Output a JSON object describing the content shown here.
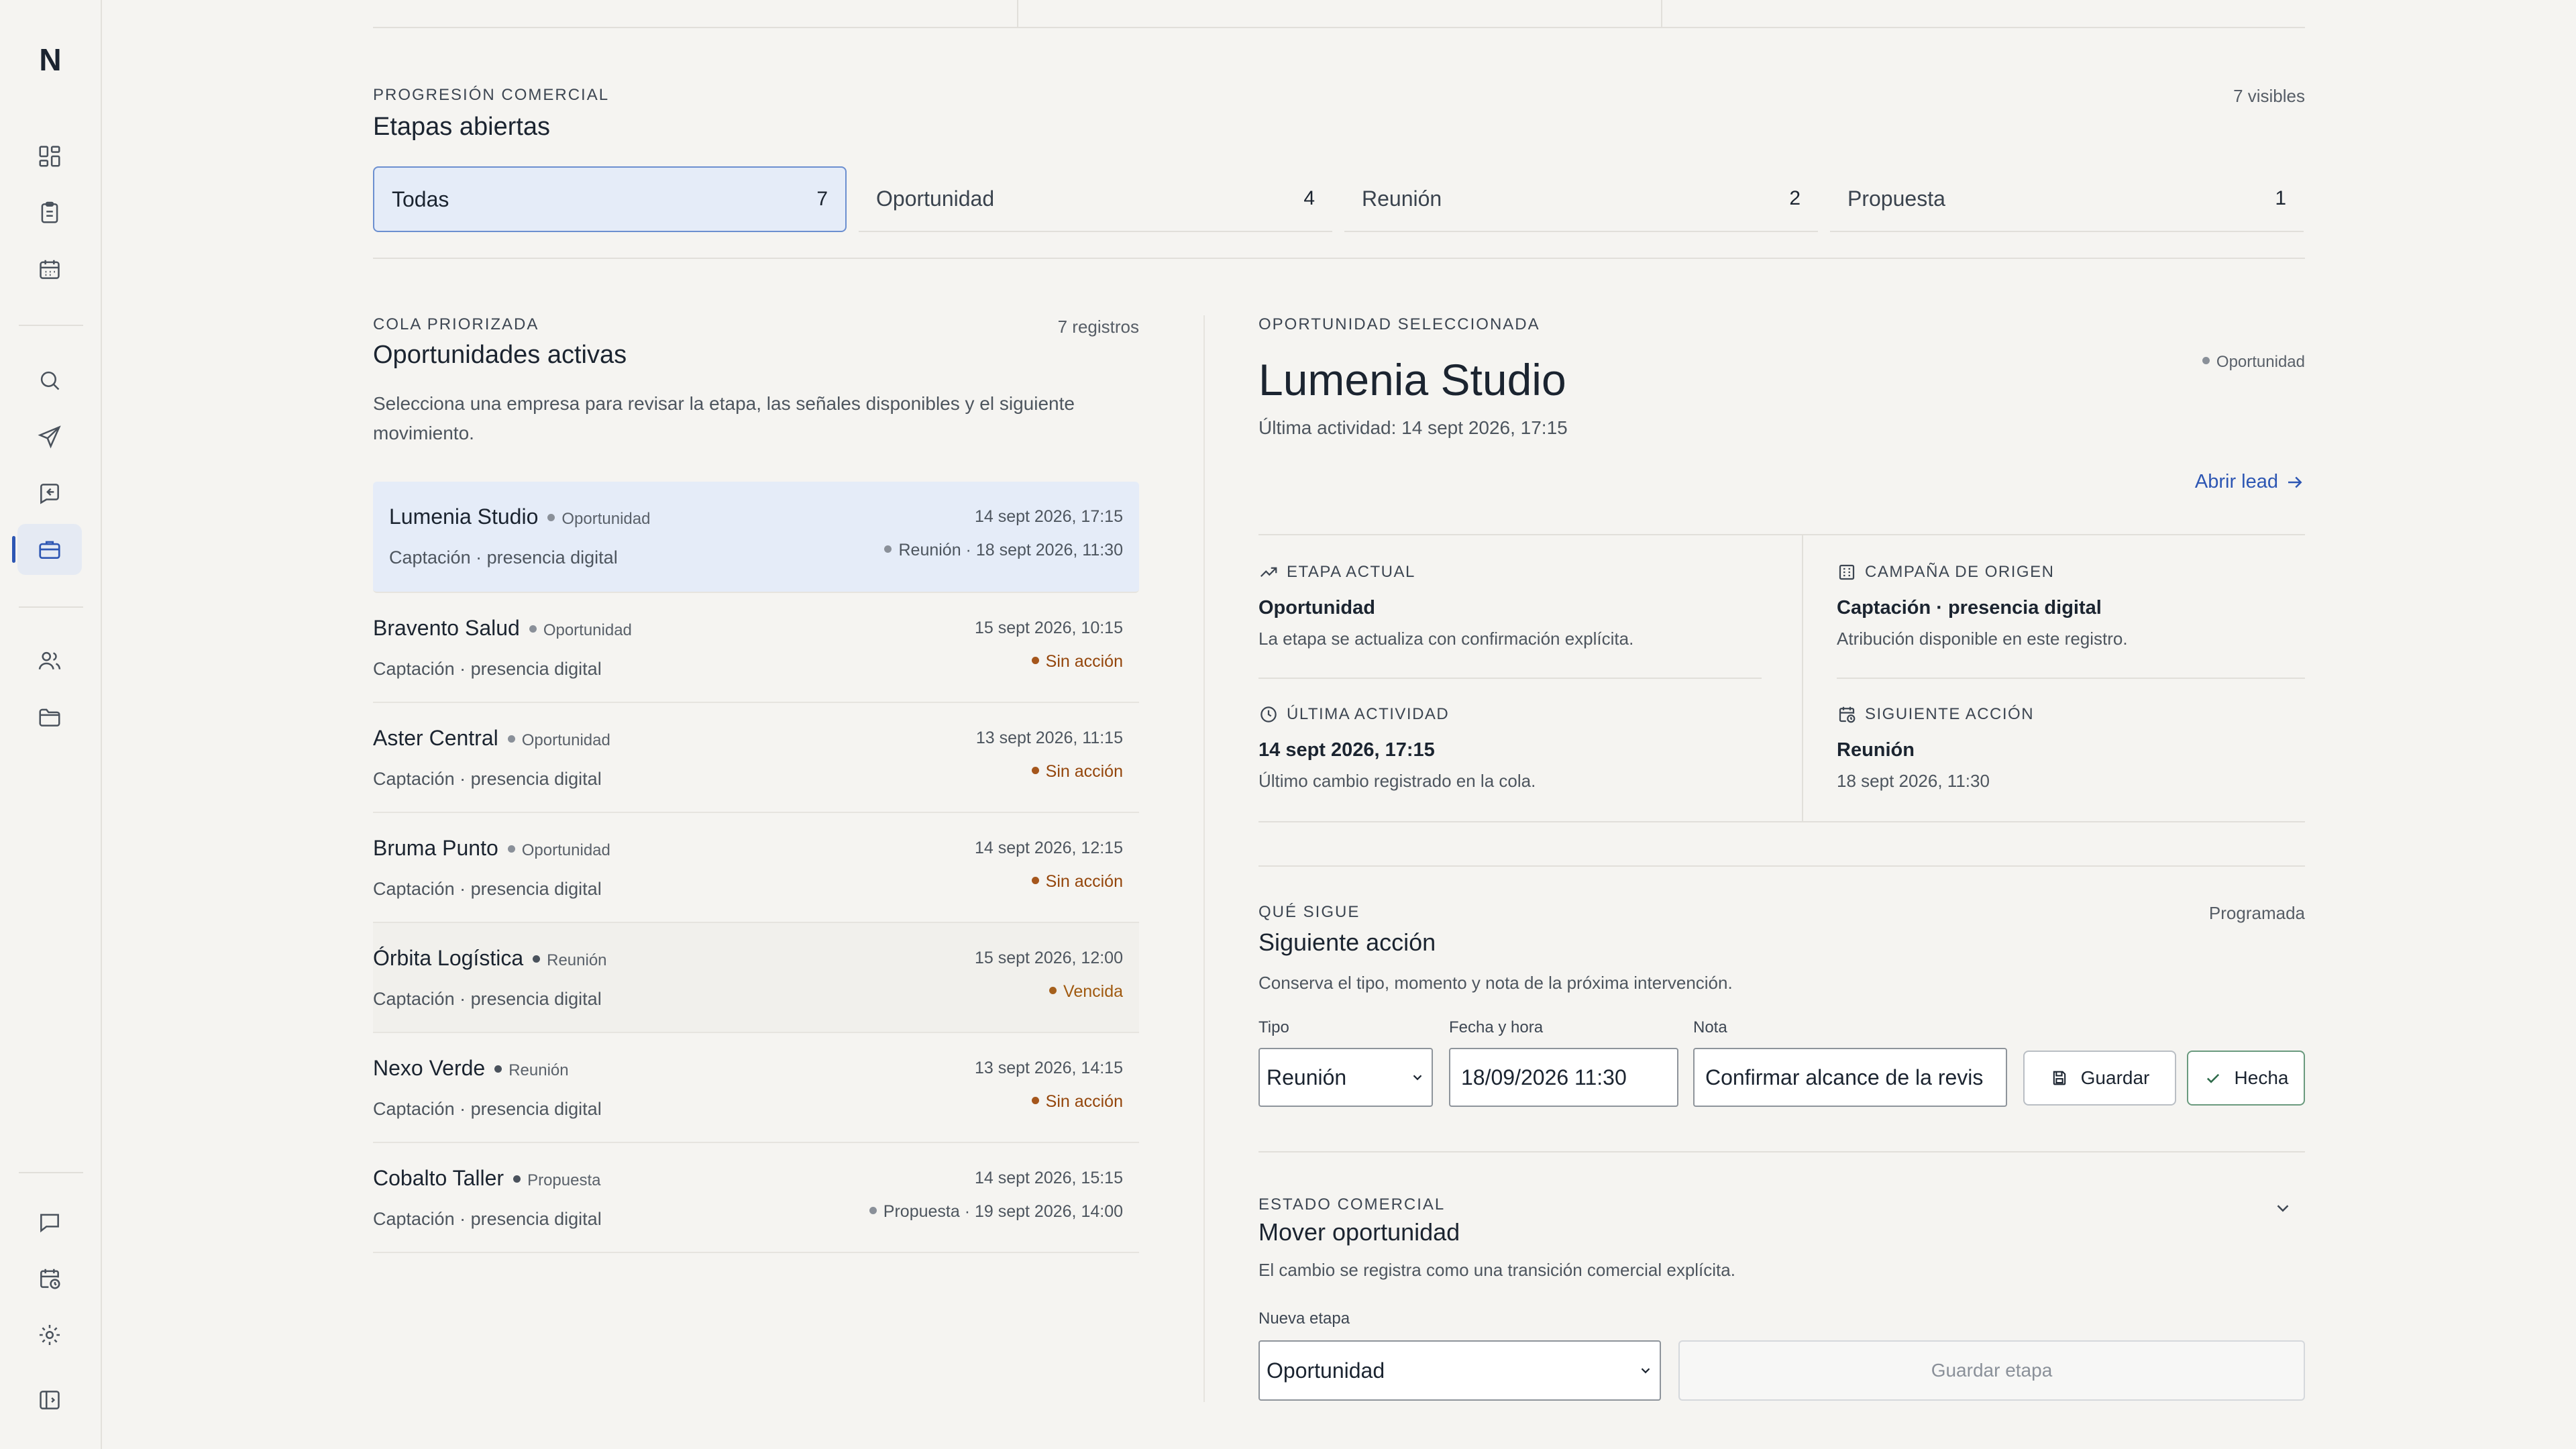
{
  "app": {
    "logo": "N"
  },
  "sidebar": {
    "items": [
      {
        "icon": "dashboard-icon"
      },
      {
        "icon": "clipboard-icon"
      },
      {
        "icon": "calendar-icon"
      },
      {
        "icon": "search-icon"
      },
      {
        "icon": "send-icon"
      },
      {
        "icon": "inbox-reply-icon"
      },
      {
        "icon": "briefcase-icon",
        "active": true
      },
      {
        "icon": "users-icon"
      },
      {
        "icon": "folder-icon"
      },
      {
        "icon": "chat-icon"
      },
      {
        "icon": "calendar-clock-icon"
      },
      {
        "icon": "gear-icon"
      },
      {
        "icon": "sidebar-toggle-icon"
      }
    ]
  },
  "stages": {
    "eyebrow": "PROGRESIÓN COMERCIAL",
    "title": "Etapas abiertas",
    "visible": "7 visibles",
    "tabs": [
      {
        "label": "Todas",
        "count": "7"
      },
      {
        "label": "Oportunidad",
        "count": "4"
      },
      {
        "label": "Reunión",
        "count": "2"
      },
      {
        "label": "Propuesta",
        "count": "1"
      }
    ]
  },
  "queue": {
    "eyebrow": "COLA PRIORIZADA",
    "title": "Oportunidades activas",
    "count": "7 registros",
    "description": "Selecciona una empresa para revisar la etapa, las señales disponibles y el siguiente movimiento.",
    "rows": [
      {
        "name": "Lumenia Studio",
        "stage": "Oportunidad",
        "campaign": "Captación · presencia digital",
        "date": "14 sept 2026, 17:15",
        "next": "Reunión · 18 sept 2026, 11:30",
        "next_type": "normal"
      },
      {
        "name": "Bravento Salud",
        "stage": "Oportunidad",
        "campaign": "Captación · presencia digital",
        "date": "15 sept 2026, 10:15",
        "next": "Sin acción",
        "next_type": "warn"
      },
      {
        "name": "Aster Central",
        "stage": "Oportunidad",
        "campaign": "Captación · presencia digital",
        "date": "13 sept 2026, 11:15",
        "next": "Sin acción",
        "next_type": "warn"
      },
      {
        "name": "Bruma Punto",
        "stage": "Oportunidad",
        "campaign": "Captación · presencia digital",
        "date": "14 sept 2026, 12:15",
        "next": "Sin acción",
        "next_type": "warn"
      },
      {
        "name": "Órbita Logística",
        "stage": "Reunión",
        "campaign": "Captación · presencia digital",
        "date": "15 sept 2026, 12:00",
        "next": "Vencida",
        "next_type": "warn"
      },
      {
        "name": "Nexo Verde",
        "stage": "Reunión",
        "campaign": "Captación · presencia digital",
        "date": "13 sept 2026, 14:15",
        "next": "Sin acción",
        "next_type": "warn"
      },
      {
        "name": "Cobalto Taller",
        "stage": "Propuesta",
        "campaign": "Captación · presencia digital",
        "date": "14 sept 2026, 15:15",
        "next": "Propuesta · 19 sept 2026, 14:00",
        "next_type": "normal"
      }
    ]
  },
  "detail": {
    "eyebrow": "OPORTUNIDAD SELECCIONADA",
    "title": "Lumenia Studio",
    "last_activity": "Última actividad: 14 sept 2026, 17:15",
    "badge": "Oportunidad",
    "open_lead": "Abrir lead",
    "cells": {
      "stage": {
        "label": "ETAPA ACTUAL",
        "value": "Oportunidad",
        "sub": "La etapa se actualiza con confirmación explícita."
      },
      "campaign": {
        "label": "CAMPAÑA DE ORIGEN",
        "value": "Captación · presencia digital",
        "sub": "Atribución disponible en este registro."
      },
      "activity": {
        "label": "ÚLTIMA ACTIVIDAD",
        "value": "14 sept 2026, 17:15",
        "sub": "Último cambio registrado en la cola."
      },
      "next": {
        "label": "SIGUIENTE ACCIÓN",
        "value": "Reunión",
        "sub": "18 sept 2026, 11:30"
      }
    }
  },
  "next_action": {
    "eyebrow": "QUÉ SIGUE",
    "title": "Siguiente acción",
    "state": "Programada",
    "description": "Conserva el tipo, momento y nota de la próxima intervención.",
    "type_label": "Tipo",
    "type_value": "Reunión",
    "datetime_label": "Fecha y hora",
    "datetime_value": "18/09/2026 11:30",
    "note_label": "Nota",
    "note_value": "Confirmar alcance de la revis",
    "save": "Guardar",
    "done": "Hecha"
  },
  "commercial_state": {
    "eyebrow": "ESTADO COMERCIAL",
    "title": "Mover oportunidad",
    "description": "El cambio se registra como una transición comercial explícita.",
    "new_stage_label": "Nueva etapa",
    "new_stage_value": "Oportunidad",
    "save": "Guardar etapa"
  }
}
